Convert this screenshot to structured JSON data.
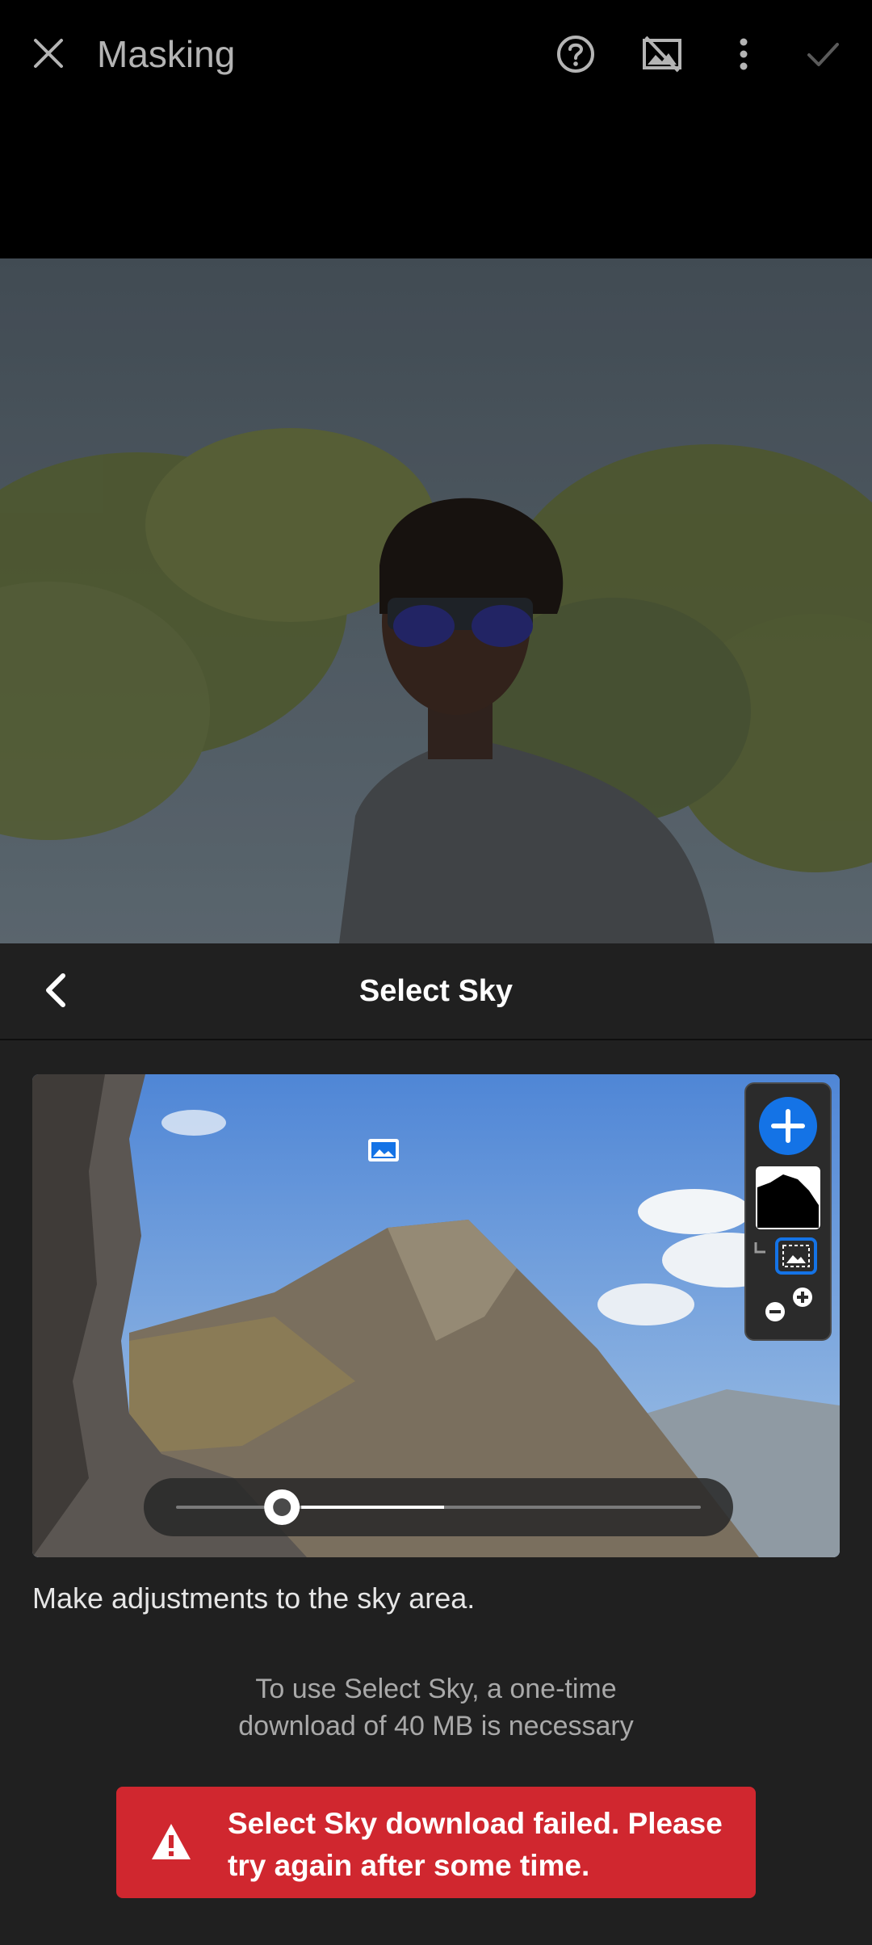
{
  "app_bar": {
    "title": "Masking",
    "icons": [
      "close-icon",
      "help-icon",
      "overlay-off-icon",
      "more-vert-icon",
      "check-icon"
    ]
  },
  "panel": {
    "title": "Select Sky",
    "description": "Make adjustments to the sky area.",
    "download_note_line1": "To use Select Sky, a one-time",
    "download_note_line2": "download of 40 MB is necessary",
    "error_message": "Select Sky download failed. Please try again after some time."
  },
  "preview": {
    "slider_progress": 0.2
  },
  "colors": {
    "accent": "#1473e6",
    "error": "#d0272f",
    "panel_bg": "#202020",
    "appbar_bg": "#000000"
  }
}
